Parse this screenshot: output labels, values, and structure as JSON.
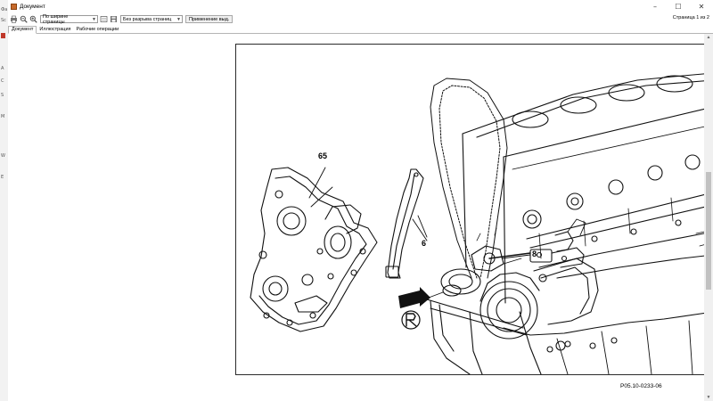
{
  "window": {
    "title": "Документ"
  },
  "toolbar": {
    "zoom_select": "По ширине страницы",
    "layout_select": "Без разрыва страниц",
    "apply_button": "Применение выд.",
    "page_indicator": "Страница 1 из 2"
  },
  "tabs": [
    {
      "label": "Документ",
      "active": true
    },
    {
      "label": "Иллюстрация",
      "active": false
    },
    {
      "label": "Рабочие операции",
      "active": false
    }
  ],
  "left_strip_labels": [
    "Фа",
    "Sc",
    "A",
    "C",
    "S",
    "M",
    "W",
    "E"
  ],
  "figure": {
    "callouts": {
      "front_cover": "65",
      "guide_rail": "6",
      "sprocket_bolt": "8"
    },
    "code": "P05.10-0233-06"
  },
  "icons": [
    "app-icon",
    "minimize-icon",
    "maximize-icon",
    "close-icon",
    "print-icon",
    "zoom-out-icon",
    "zoom-in-icon",
    "page-icon",
    "save-icon",
    "dropdown-arrow-icon",
    "arrow-icon",
    "tool-icon"
  ]
}
